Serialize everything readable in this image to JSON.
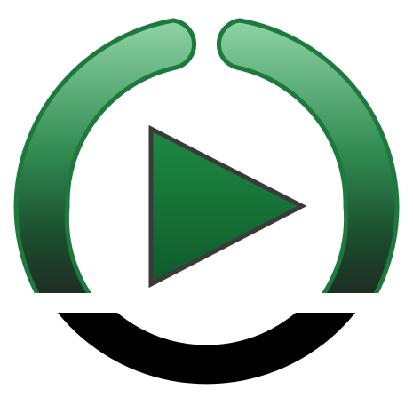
{
  "icon": {
    "name": "play-icon",
    "ring_name": "power-ring",
    "colors": {
      "ring_top": "#8fd3a6",
      "ring_mid": "#2f8a4f",
      "ring_dark": "#1b4d2e",
      "ring_bottom": "#1f1f1f",
      "ring_outline": "#1e7a3c",
      "base_band": "#000000",
      "triangle_top": "#1e8a44",
      "triangle_bottom": "#0f5a2a",
      "triangle_outline": "#3a3a3a",
      "background": "#ffffff"
    }
  }
}
